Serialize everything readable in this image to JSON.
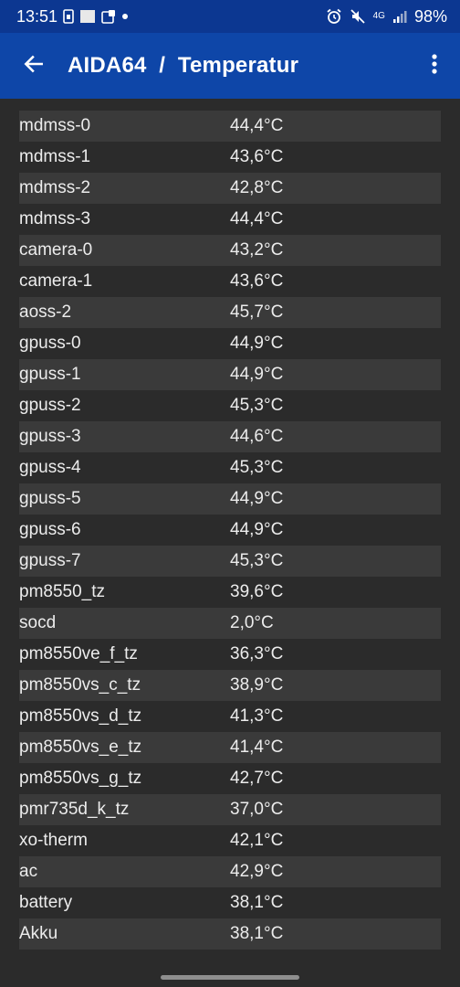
{
  "status_bar": {
    "time": "13:51",
    "net_label": "4G",
    "battery": "98%",
    "icons": [
      "sim-icon",
      "screen-icon",
      "notification-icon",
      "dot-icon",
      "alarm-icon",
      "mute-icon",
      "signal-icon"
    ]
  },
  "app_bar": {
    "title": "AIDA64  /  Temperatur",
    "back_icon": "arrow-left-icon",
    "menu_icon": "more-vert-icon"
  },
  "sensors": [
    {
      "name": "mdmss-0",
      "value": "44,4°C"
    },
    {
      "name": "mdmss-1",
      "value": "43,6°C"
    },
    {
      "name": "mdmss-2",
      "value": "42,8°C"
    },
    {
      "name": "mdmss-3",
      "value": "44,4°C"
    },
    {
      "name": "camera-0",
      "value": "43,2°C"
    },
    {
      "name": "camera-1",
      "value": "43,6°C"
    },
    {
      "name": "aoss-2",
      "value": "45,7°C"
    },
    {
      "name": "gpuss-0",
      "value": "44,9°C"
    },
    {
      "name": "gpuss-1",
      "value": "44,9°C"
    },
    {
      "name": "gpuss-2",
      "value": "45,3°C"
    },
    {
      "name": "gpuss-3",
      "value": "44,6°C"
    },
    {
      "name": "gpuss-4",
      "value": "45,3°C"
    },
    {
      "name": "gpuss-5",
      "value": "44,9°C"
    },
    {
      "name": "gpuss-6",
      "value": "44,9°C"
    },
    {
      "name": "gpuss-7",
      "value": "45,3°C"
    },
    {
      "name": "pm8550_tz",
      "value": "39,6°C"
    },
    {
      "name": "socd",
      "value": "2,0°C"
    },
    {
      "name": "pm8550ve_f_tz",
      "value": "36,3°C"
    },
    {
      "name": "pm8550vs_c_tz",
      "value": "38,9°C"
    },
    {
      "name": "pm8550vs_d_tz",
      "value": "41,3°C"
    },
    {
      "name": "pm8550vs_e_tz",
      "value": "41,4°C"
    },
    {
      "name": "pm8550vs_g_tz",
      "value": "42,7°C"
    },
    {
      "name": "pmr735d_k_tz",
      "value": "37,0°C"
    },
    {
      "name": "xo-therm",
      "value": "42,1°C"
    },
    {
      "name": "ac",
      "value": "42,9°C"
    },
    {
      "name": "battery",
      "value": "38,1°C"
    },
    {
      "name": "Akku",
      "value": "38,1°C"
    }
  ]
}
